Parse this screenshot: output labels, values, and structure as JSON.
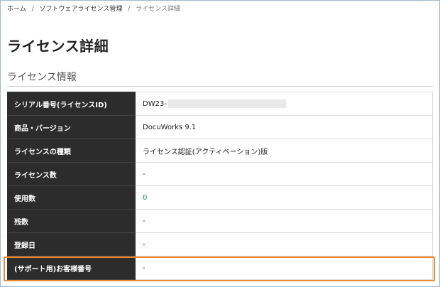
{
  "breadcrumb": {
    "home": "ホーム",
    "software_license": "ソフトウェアライセンス管理",
    "current": "ライセンス詳細",
    "separator": "/"
  },
  "page_title": "ライセンス詳細",
  "section_title": "ライセンス情報",
  "table": {
    "rows": [
      {
        "label": "シリアル番号(ライセンスID)",
        "value": "DW23-"
      },
      {
        "label": "商品・バージョン",
        "value": "DocuWorks 9.1"
      },
      {
        "label": "ライセンスの種類",
        "value": "ライセンス認証(アクティベーション)版"
      },
      {
        "label": "ライセンス数",
        "value": "-"
      },
      {
        "label": "使用数",
        "value": "0"
      },
      {
        "label": "残数",
        "value": "-"
      },
      {
        "label": "登録日",
        "value": "-"
      },
      {
        "label": "(サポート用)お客様番号",
        "value": "-"
      }
    ]
  },
  "colors": {
    "header_bg": "#2c2c2c",
    "highlight": "#f08a32",
    "used_count": "#1a8a6e"
  }
}
